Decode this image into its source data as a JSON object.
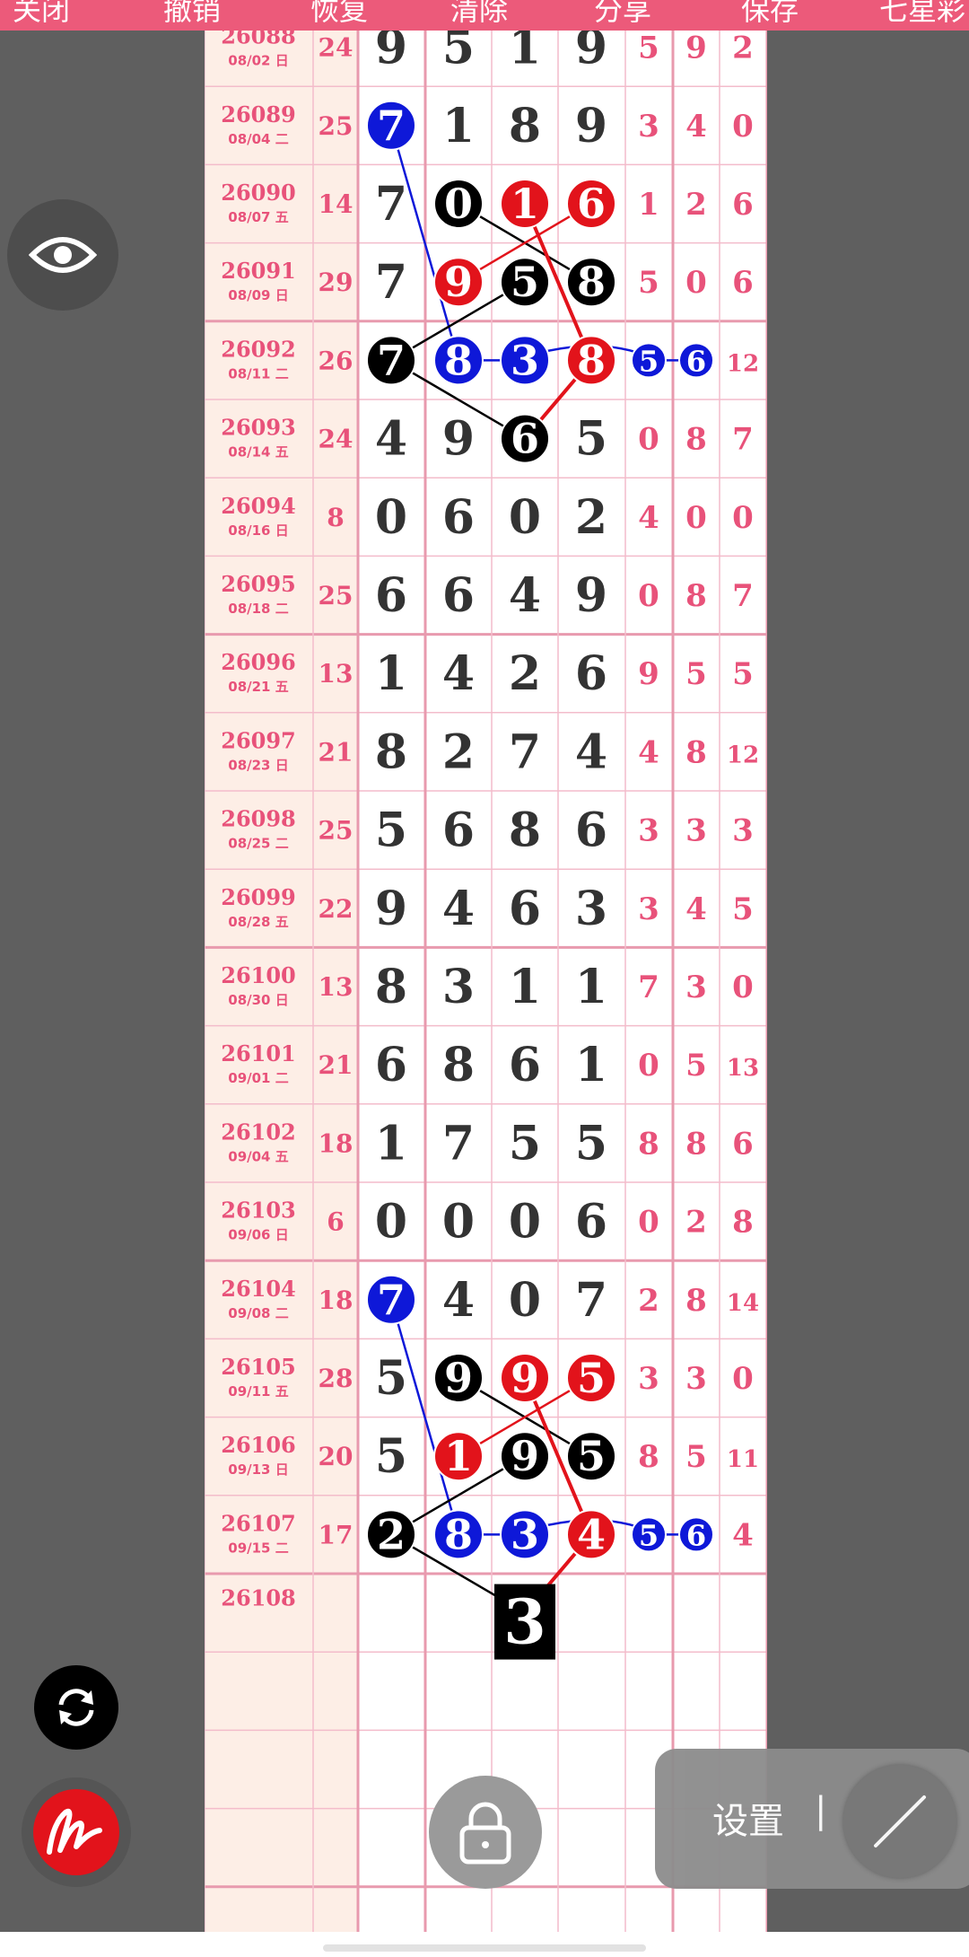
{
  "toolbar": {
    "items": [
      "关闭",
      "撤销",
      "恢复",
      "清除",
      "分享",
      "保存",
      "七星彩"
    ]
  },
  "colors": {
    "pink": "#e8527a",
    "red": "#e2131b",
    "blue": "#0e18d8",
    "black": "#000000",
    "grid_line": "#f3bccb",
    "left_bg": "#fdeee6"
  },
  "rows": [
    {
      "issue": "26088",
      "date": "08/02 日",
      "sum": "24",
      "digits": [
        9,
        5,
        1,
        9
      ],
      "extras": [
        "5",
        "9",
        "2"
      ]
    },
    {
      "issue": "26089",
      "date": "08/04 二",
      "sum": "25",
      "digits": [
        7,
        1,
        8,
        9
      ],
      "extras": [
        "3",
        "4",
        "0"
      ]
    },
    {
      "issue": "26090",
      "date": "08/07 五",
      "sum": "14",
      "digits": [
        7,
        0,
        1,
        6
      ],
      "extras": [
        "1",
        "2",
        "6"
      ]
    },
    {
      "issue": "26091",
      "date": "08/09 日",
      "sum": "29",
      "digits": [
        7,
        9,
        5,
        8
      ],
      "extras": [
        "5",
        "0",
        "6"
      ]
    },
    {
      "issue": "26092",
      "date": "08/11 二",
      "sum": "26",
      "digits": [
        7,
        8,
        3,
        8
      ],
      "extras": [
        "5",
        "6",
        "12"
      ]
    },
    {
      "issue": "26093",
      "date": "08/14 五",
      "sum": "24",
      "digits": [
        4,
        9,
        6,
        5
      ],
      "extras": [
        "0",
        "8",
        "7"
      ]
    },
    {
      "issue": "26094",
      "date": "08/16 日",
      "sum": "8",
      "digits": [
        0,
        6,
        0,
        2
      ],
      "extras": [
        "4",
        "0",
        "0"
      ]
    },
    {
      "issue": "26095",
      "date": "08/18 二",
      "sum": "25",
      "digits": [
        6,
        6,
        4,
        9
      ],
      "extras": [
        "0",
        "8",
        "7"
      ]
    },
    {
      "issue": "26096",
      "date": "08/21 五",
      "sum": "13",
      "digits": [
        1,
        4,
        2,
        6
      ],
      "extras": [
        "9",
        "5",
        "5"
      ]
    },
    {
      "issue": "26097",
      "date": "08/23 日",
      "sum": "21",
      "digits": [
        8,
        2,
        7,
        4
      ],
      "extras": [
        "4",
        "8",
        "12"
      ]
    },
    {
      "issue": "26098",
      "date": "08/25 二",
      "sum": "25",
      "digits": [
        5,
        6,
        8,
        6
      ],
      "extras": [
        "3",
        "3",
        "3"
      ]
    },
    {
      "issue": "26099",
      "date": "08/28 五",
      "sum": "22",
      "digits": [
        9,
        4,
        6,
        3
      ],
      "extras": [
        "3",
        "4",
        "5"
      ]
    },
    {
      "issue": "26100",
      "date": "08/30 日",
      "sum": "13",
      "digits": [
        8,
        3,
        1,
        1
      ],
      "extras": [
        "7",
        "3",
        "0"
      ]
    },
    {
      "issue": "26101",
      "date": "09/01 二",
      "sum": "21",
      "digits": [
        6,
        8,
        6,
        1
      ],
      "extras": [
        "0",
        "5",
        "13"
      ]
    },
    {
      "issue": "26102",
      "date": "09/04 五",
      "sum": "18",
      "digits": [
        1,
        7,
        5,
        5
      ],
      "extras": [
        "8",
        "8",
        "6"
      ]
    },
    {
      "issue": "26103",
      "date": "09/06 日",
      "sum": "6",
      "digits": [
        0,
        0,
        0,
        6
      ],
      "extras": [
        "0",
        "2",
        "8"
      ]
    },
    {
      "issue": "26104",
      "date": "09/08 二",
      "sum": "18",
      "digits": [
        7,
        4,
        0,
        7
      ],
      "extras": [
        "2",
        "8",
        "14"
      ]
    },
    {
      "issue": "26105",
      "date": "09/11 五",
      "sum": "28",
      "digits": [
        5,
        9,
        9,
        5
      ],
      "extras": [
        "3",
        "3",
        "0"
      ]
    },
    {
      "issue": "26106",
      "date": "09/13 日",
      "sum": "20",
      "digits": [
        5,
        1,
        9,
        5
      ],
      "extras": [
        "8",
        "5",
        "11"
      ]
    },
    {
      "issue": "26107",
      "date": "09/15 二",
      "sum": "17",
      "digits": [
        2,
        8,
        3,
        4
      ],
      "extras": [
        "5",
        "6",
        "4"
      ]
    },
    {
      "issue": "26108",
      "date": "",
      "sum": "",
      "digits": [],
      "extras": []
    }
  ],
  "circles": [
    {
      "row": 1,
      "col": 0,
      "color": "blue"
    },
    {
      "row": 2,
      "col": 1,
      "color": "black"
    },
    {
      "row": 2,
      "col": 2,
      "color": "red"
    },
    {
      "row": 2,
      "col": 3,
      "color": "red"
    },
    {
      "row": 3,
      "col": 1,
      "color": "red"
    },
    {
      "row": 3,
      "col": 2,
      "color": "black"
    },
    {
      "row": 3,
      "col": 3,
      "color": "black"
    },
    {
      "row": 4,
      "col": 0,
      "color": "black"
    },
    {
      "row": 4,
      "col": 1,
      "color": "blue"
    },
    {
      "row": 4,
      "col": 2,
      "color": "blue"
    },
    {
      "row": 4,
      "col": 3,
      "color": "red"
    },
    {
      "row": 4,
      "col": 4,
      "color": "blue",
      "small": true
    },
    {
      "row": 4,
      "col": 5,
      "color": "blue",
      "small": true
    },
    {
      "row": 5,
      "col": 2,
      "color": "black"
    },
    {
      "row": 16,
      "col": 0,
      "color": "blue"
    },
    {
      "row": 17,
      "col": 1,
      "color": "black"
    },
    {
      "row": 17,
      "col": 2,
      "color": "red"
    },
    {
      "row": 17,
      "col": 3,
      "color": "red"
    },
    {
      "row": 18,
      "col": 1,
      "color": "red"
    },
    {
      "row": 18,
      "col": 2,
      "color": "black"
    },
    {
      "row": 18,
      "col": 3,
      "color": "black"
    },
    {
      "row": 19,
      "col": 0,
      "color": "black"
    },
    {
      "row": 19,
      "col": 1,
      "color": "blue"
    },
    {
      "row": 19,
      "col": 2,
      "color": "blue"
    },
    {
      "row": 19,
      "col": 3,
      "color": "red"
    },
    {
      "row": 19,
      "col": 4,
      "color": "blue",
      "small": true
    },
    {
      "row": 19,
      "col": 5,
      "color": "blue",
      "small": true
    }
  ],
  "highlight": {
    "row": 20,
    "col": 2,
    "value": "3"
  },
  "settings": {
    "label": "设置",
    "separator": "|"
  }
}
